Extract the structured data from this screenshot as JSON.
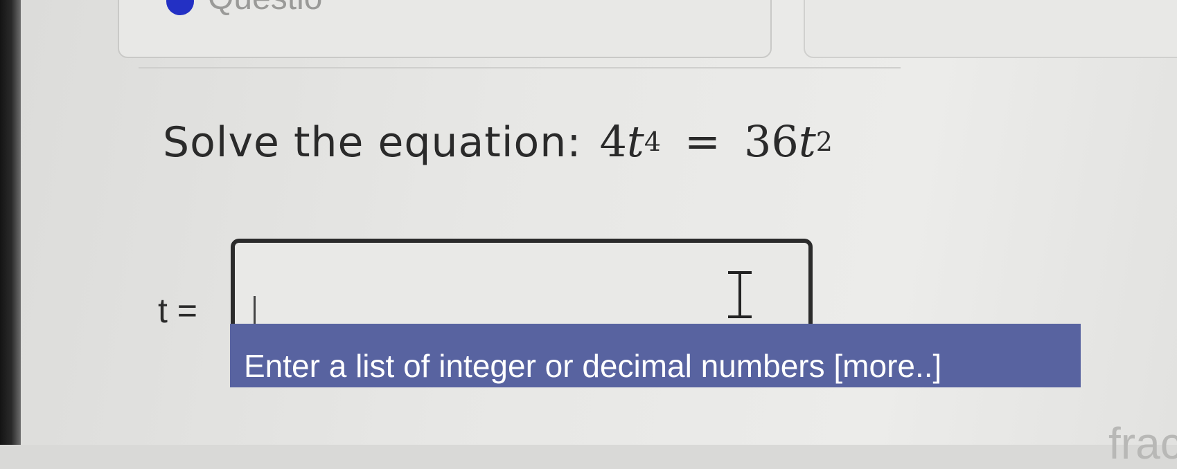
{
  "header": {
    "section_title": "Questio"
  },
  "question": {
    "prompt": "Solve the equation:",
    "lhs_coefficient": "4",
    "lhs_variable": "t",
    "lhs_exponent": "4",
    "operator": "=",
    "rhs_coefficient": "36",
    "rhs_variable": "t",
    "rhs_exponent": "2"
  },
  "answer": {
    "label": "t =",
    "value": "",
    "placeholder": ""
  },
  "hint": {
    "text": "Enter a list of integer or decimal numbers ",
    "more_link": "[more..]"
  },
  "footer": {
    "partial_text": "fractio"
  },
  "colors": {
    "accent_dot": "#2330c4",
    "hint_background": "#5863a0"
  },
  "icons": [
    "text-cursor-ibeam-icon"
  ]
}
